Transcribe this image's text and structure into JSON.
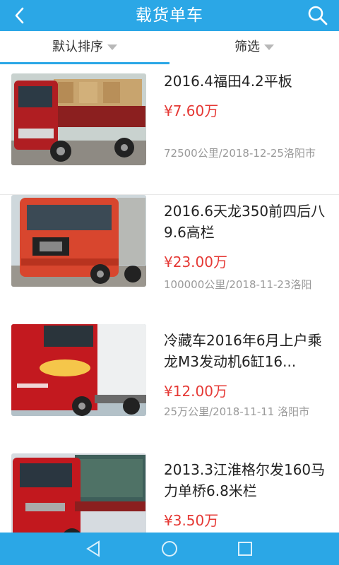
{
  "header": {
    "title": "载货单车",
    "back_icon": "chevron-left-icon",
    "search_icon": "search-icon"
  },
  "sort": {
    "default_label": "默认排序",
    "filter_label": "筛选"
  },
  "listings": [
    {
      "title": "2016.4福田4.2平板",
      "price": "¥7.60万",
      "meta": "72500公里/2018-12-25洛阳市"
    },
    {
      "title": "2016.6天龙350前四后八9.6高栏",
      "price": "¥23.00万",
      "meta": "100000公里/2018-11-23洛阳"
    },
    {
      "title": "冷藏车2016年6月上户乘龙M3发动机6缸16...",
      "price": "¥12.00万",
      "meta": "25万公里/2018-11-11 洛阳市"
    },
    {
      "title": "2013.3江淮格尔发160马力单桥6.8米栏",
      "price": "¥3.50万",
      "meta": ""
    }
  ],
  "colors": {
    "accent": "#2ba7e6",
    "price": "#e53935"
  }
}
